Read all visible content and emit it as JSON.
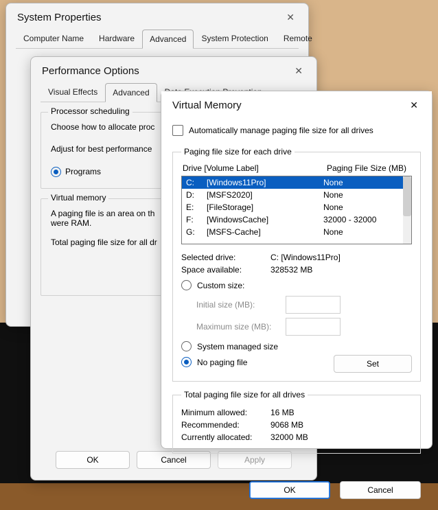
{
  "sysprops": {
    "title": "System Properties",
    "tabs": [
      "Computer Name",
      "Hardware",
      "Advanced",
      "System Protection",
      "Remote"
    ],
    "activeTabIndex": 2
  },
  "perf": {
    "title": "Performance Options",
    "tabs": [
      "Visual Effects",
      "Advanced",
      "Data Execution Prevention"
    ],
    "activeTabIndex": 1,
    "groups": {
      "scheduling": {
        "title": "Processor scheduling",
        "desc": "Choose how to allocate proc",
        "adjust": "Adjust for best performance",
        "programs": "Programs"
      },
      "vm": {
        "title": "Virtual memory",
        "desc1": "A paging file is an area on th",
        "desc2": "were RAM.",
        "total": "Total paging file size for all dr"
      }
    },
    "buttons": {
      "ok": "OK",
      "cancel": "Cancel",
      "apply": "Apply"
    }
  },
  "vm": {
    "title": "Virtual Memory",
    "autoManage": "Automatically manage paging file size for all drives",
    "groupDrives": "Paging file size for each drive",
    "head": {
      "left": "Drive  [Volume Label]",
      "right": "Paging File Size (MB)"
    },
    "drives": [
      {
        "letter": "C:",
        "label": "[Windows11Pro]",
        "size": "None",
        "selected": true
      },
      {
        "letter": "D:",
        "label": "[MSFS2020]",
        "size": "None"
      },
      {
        "letter": "E:",
        "label": "[FileStorage]",
        "size": "None"
      },
      {
        "letter": "F:",
        "label": "[WindowsCache]",
        "size": "32000 - 32000"
      },
      {
        "letter": "G:",
        "label": "[MSFS-Cache]",
        "size": "None"
      }
    ],
    "selectedDrive": {
      "k": "Selected drive:",
      "v": "C:  [Windows11Pro]"
    },
    "spaceAvail": {
      "k": "Space available:",
      "v": "328532 MB"
    },
    "custom": "Custom size:",
    "initial": "Initial size (MB):",
    "maximum": "Maximum size (MB):",
    "managed": "System managed size",
    "none": "No paging file",
    "set": "Set",
    "totalsTitle": "Total paging file size for all drives",
    "minAllowed": {
      "k": "Minimum allowed:",
      "v": "16 MB"
    },
    "recommended": {
      "k": "Recommended:",
      "v": "9068 MB"
    },
    "current": {
      "k": "Currently allocated:",
      "v": "32000 MB"
    },
    "ok": "OK",
    "cancel": "Cancel"
  }
}
